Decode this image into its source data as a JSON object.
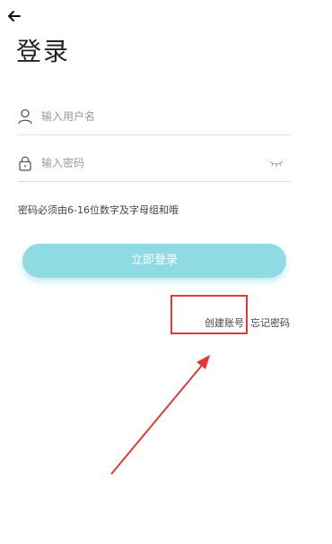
{
  "header": {
    "back_icon": "arrow-left-icon",
    "title": "登录"
  },
  "form": {
    "username": {
      "icon": "user-icon",
      "placeholder": "输入用户名",
      "value": ""
    },
    "password": {
      "icon": "lock-icon",
      "placeholder": "输入密码",
      "value": "",
      "toggle_icon": "eye-closed-icon"
    },
    "hint": "密码必须由6-16位数字及字母组和哦"
  },
  "actions": {
    "login_label": "立即登录",
    "create_account_label": "创建账号",
    "forgot_password_label": "忘记密码"
  },
  "colors": {
    "login_button": "#8fdbe3",
    "annotation": "#e53935"
  }
}
